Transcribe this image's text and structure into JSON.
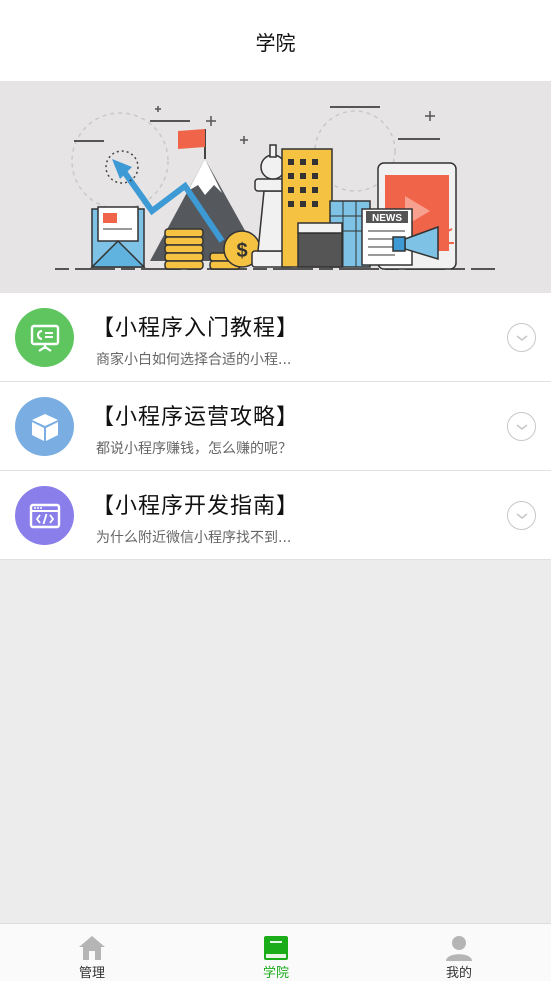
{
  "header": {
    "title": "学院"
  },
  "banner": {
    "news_label": "NEWS",
    "coin_symbol": "$"
  },
  "courses": [
    {
      "title": "【小程序入门教程】",
      "desc": "商家小白如何选择合适的小程...",
      "icon": "presentation-icon",
      "color": "#5ec55f"
    },
    {
      "title": "【小程序运营攻略】",
      "desc": "都说小程序赚钱，怎么赚的呢？",
      "icon": "box-icon",
      "color": "#7aaee3"
    },
    {
      "title": "【小程序开发指南】",
      "desc": "为什么附近微信小程序找不到...",
      "icon": "code-window-icon",
      "color": "#8a7fea"
    }
  ],
  "tabbar": {
    "items": [
      {
        "label": "管理",
        "icon": "home-icon"
      },
      {
        "label": "学院",
        "icon": "book-icon",
        "active": true
      },
      {
        "label": "我的",
        "icon": "user-icon"
      }
    ]
  },
  "colors": {
    "active": "#1aad19",
    "inactive_icon": "#b5b5b5",
    "background": "#ececec"
  }
}
